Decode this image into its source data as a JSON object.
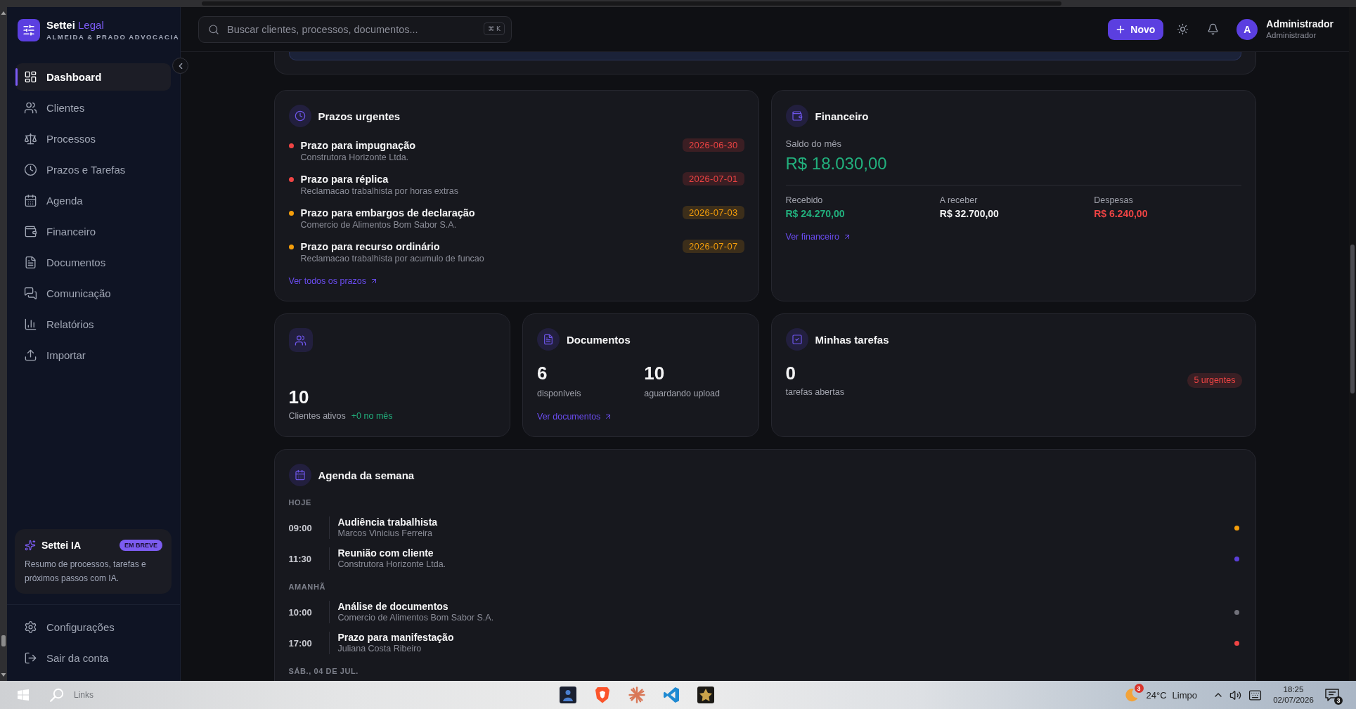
{
  "brand": {
    "name": "Settei",
    "accent": "Legal",
    "firm": "ALMEIDA & PRADO ADVOCACIA"
  },
  "sidebar": {
    "items": [
      {
        "label": "Dashboard",
        "selected": true
      },
      {
        "label": "Clientes",
        "selected": false
      },
      {
        "label": "Processos",
        "selected": false
      },
      {
        "label": "Prazos e Tarefas",
        "selected": false
      },
      {
        "label": "Agenda",
        "selected": false
      },
      {
        "label": "Financeiro",
        "selected": false
      },
      {
        "label": "Documentos",
        "selected": false
      },
      {
        "label": "Comunicação",
        "selected": false
      },
      {
        "label": "Relatórios",
        "selected": false
      },
      {
        "label": "Importar",
        "selected": false
      }
    ],
    "ai_card": {
      "title": "Settei IA",
      "badge": "EM BREVE",
      "text": "Resumo de processos, tarefas e próximos passos com IA."
    },
    "footer_items": [
      {
        "label": "Configurações"
      },
      {
        "label": "Sair da conta"
      }
    ]
  },
  "topbar": {
    "search": {
      "placeholder": "Buscar clientes, processos, documentos...",
      "shortcut": "⌘ K"
    },
    "new_button": "Novo",
    "user": {
      "initial": "A",
      "name": "Administrador",
      "role": "Administrador"
    }
  },
  "deadlines": {
    "title": "Prazos urgentes",
    "items": [
      {
        "title": "Prazo para impugnação",
        "subtitle": "Construtora Horizonte Ltda.",
        "date": "2026-06-30",
        "color": "#ef4444"
      },
      {
        "title": "Prazo para réplica",
        "subtitle": "Reclamacao trabalhista por horas extras",
        "date": "2026-07-01",
        "color": "#ef4444"
      },
      {
        "title": "Prazo para embargos de declaração",
        "subtitle": "Comercio de Alimentos Bom Sabor S.A.",
        "date": "2026-07-03",
        "color": "#f59e0b"
      },
      {
        "title": "Prazo para recurso ordinário",
        "subtitle": "Reclamacao trabalhista por acumulo de funcao",
        "date": "2026-07-07",
        "color": "#f59e0b"
      }
    ],
    "link": "Ver todos os prazos"
  },
  "finance": {
    "title": "Financeiro",
    "balance_label": "Saldo do mês",
    "balance": "R$ 18.030,00",
    "stats": [
      {
        "label": "Recebido",
        "value": "R$ 24.270,00",
        "color": "#22b07d"
      },
      {
        "label": "A receber",
        "value": "R$ 32.700,00",
        "color": "#f4f4f5"
      },
      {
        "label": "Despesas",
        "value": "R$ 6.240,00",
        "color": "#ef4444"
      }
    ],
    "link": "Ver financeiro"
  },
  "clients": {
    "count": "10",
    "label": "Clientes ativos",
    "delta": "+0 no mês"
  },
  "documents": {
    "title": "Documentos",
    "stats": [
      {
        "value": "6",
        "label": "disponíveis"
      },
      {
        "value": "10",
        "label": "aguardando upload"
      }
    ],
    "link": "Ver documentos"
  },
  "tasks": {
    "title": "Minhas tarefas",
    "count": "0",
    "label": "tarefas abertas",
    "badge": "5 urgentes"
  },
  "agenda": {
    "title": "Agenda da semana",
    "groups": [
      {
        "label": "HOJE",
        "events": [
          {
            "time": "09:00",
            "title": "Audiência trabalhista",
            "subtitle": "Marcos Vinicius Ferreira",
            "color": "#f59e0b"
          },
          {
            "time": "11:30",
            "title": "Reunião com cliente",
            "subtitle": "Construtora Horizonte Ltda.",
            "color": "#5b3fd9"
          }
        ]
      },
      {
        "label": "AMANHÃ",
        "events": [
          {
            "time": "10:00",
            "title": "Análise de documentos",
            "subtitle": "Comercio de Alimentos Bom Sabor S.A.",
            "color": "#71717a"
          },
          {
            "time": "17:00",
            "title": "Prazo para manifestação",
            "subtitle": "Juliana Costa Ribeiro",
            "color": "#ef4444"
          }
        ]
      },
      {
        "label": "SÁB., 04 DE JUL."
      }
    ]
  },
  "taskbar": {
    "search_text": "Links",
    "weather": {
      "badge": "3",
      "temperature": "24°C",
      "condition": "Limpo"
    },
    "clock": {
      "time": "18:25",
      "date": "02/07/2026"
    },
    "notifications": "3"
  }
}
